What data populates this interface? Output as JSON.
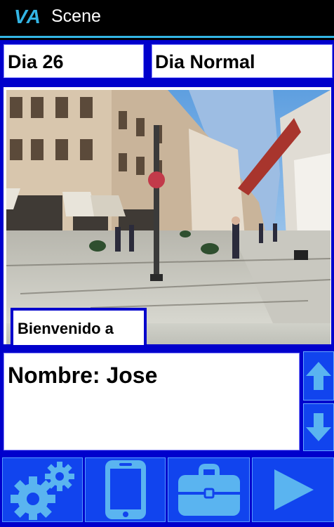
{
  "app": {
    "logo": "VA",
    "title": "Scene"
  },
  "scene": {
    "day_label": "Dia 26",
    "day_type": "Dia Normal",
    "welcome_text": "Bienvenido a",
    "name_text": "Nombre: Jose",
    "image_description": "pedestrian-street-photo"
  },
  "colors": {
    "accent": "#33b5e5",
    "panel": "#0000cc",
    "button": "#1144ee",
    "icon": "#5ab4f0"
  },
  "buttons": {
    "up": "arrow-up-icon",
    "down": "arrow-down-icon",
    "settings": "gear-icon",
    "phone": "phone-icon",
    "bag": "briefcase-icon",
    "play": "play-icon"
  }
}
